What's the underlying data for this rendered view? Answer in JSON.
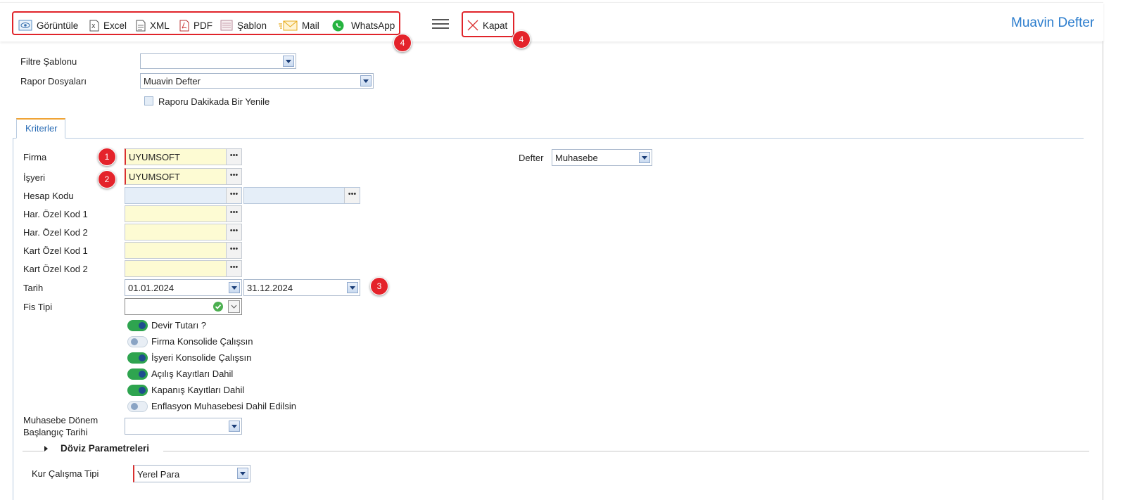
{
  "toolbar": {
    "view_label": "Görüntüle",
    "excel_label": "Excel",
    "xml_label": "XML",
    "pdf_label": "PDF",
    "template_label": "Şablon",
    "mail_label": "Mail",
    "whatsapp_label": "WhatsApp",
    "close_label": "Kapat",
    "badge_export": "4",
    "badge_close": "4"
  },
  "page_title": "Muavin Defter",
  "top_form": {
    "filter_template_label": "Filtre Şablonu",
    "filter_template_value": "",
    "report_files_label": "Rapor Dosyaları",
    "report_files_value": "Muavin Defter",
    "refresh_label": "Raporu Dakikada Bir Yenile",
    "refresh_checked": false
  },
  "tabs": [
    {
      "label": "Kriterler",
      "active": true
    }
  ],
  "criteria": {
    "firma_label": "Firma",
    "firma_value": "UYUMSOFT",
    "firma_badge": "1",
    "isyeri_label": "İşyeri",
    "isyeri_value": "UYUMSOFT",
    "isyeri_badge": "2",
    "hesap_kodu_label": "Hesap Kodu",
    "hesap_kodu_from": "",
    "hesap_kodu_to": "",
    "har_ozel_kod1_label": "Har. Özel Kod 1",
    "har_ozel_kod2_label": "Har. Özel Kod 2",
    "kart_ozel_kod1_label": "Kart Özel Kod 1",
    "kart_ozel_kod2_label": "Kart Özel Kod 2",
    "tarih_label": "Tarih",
    "tarih_from": "01.01.2024",
    "tarih_to": "31.12.2024",
    "tarih_badge": "3",
    "fis_tipi_label": "Fis Tipi",
    "fis_tipi_value": "",
    "defter_label": "Defter",
    "defter_value": "Muhasebe",
    "toggles": [
      {
        "label": "Devir Tutarı ?",
        "on": true
      },
      {
        "label": "Firma Konsolide Çalışsın",
        "on": false
      },
      {
        "label": "İşyeri Konsolide Çalışsın",
        "on": true
      },
      {
        "label": "Açılış Kayıtları Dahil",
        "on": true
      },
      {
        "label": "Kapanış Kayıtları Dahil",
        "on": true
      },
      {
        "label": "Enflasyon Muhasebesi Dahil Edilsin",
        "on": false
      }
    ],
    "donem_label_line1": "Muhasebe Dönem",
    "donem_label_line2": "Başlangıç Tarihi",
    "donem_value": ""
  },
  "doviz": {
    "section_title": "Döviz Parametreleri",
    "kur_label": "Kur Çalışma Tipi",
    "kur_value": "Yerel Para"
  },
  "colors": {
    "accent": "#2a7ccd",
    "badge": "#e4232b",
    "toggle_on": "#2ea44f",
    "required_bg": "#fdfbd3"
  }
}
